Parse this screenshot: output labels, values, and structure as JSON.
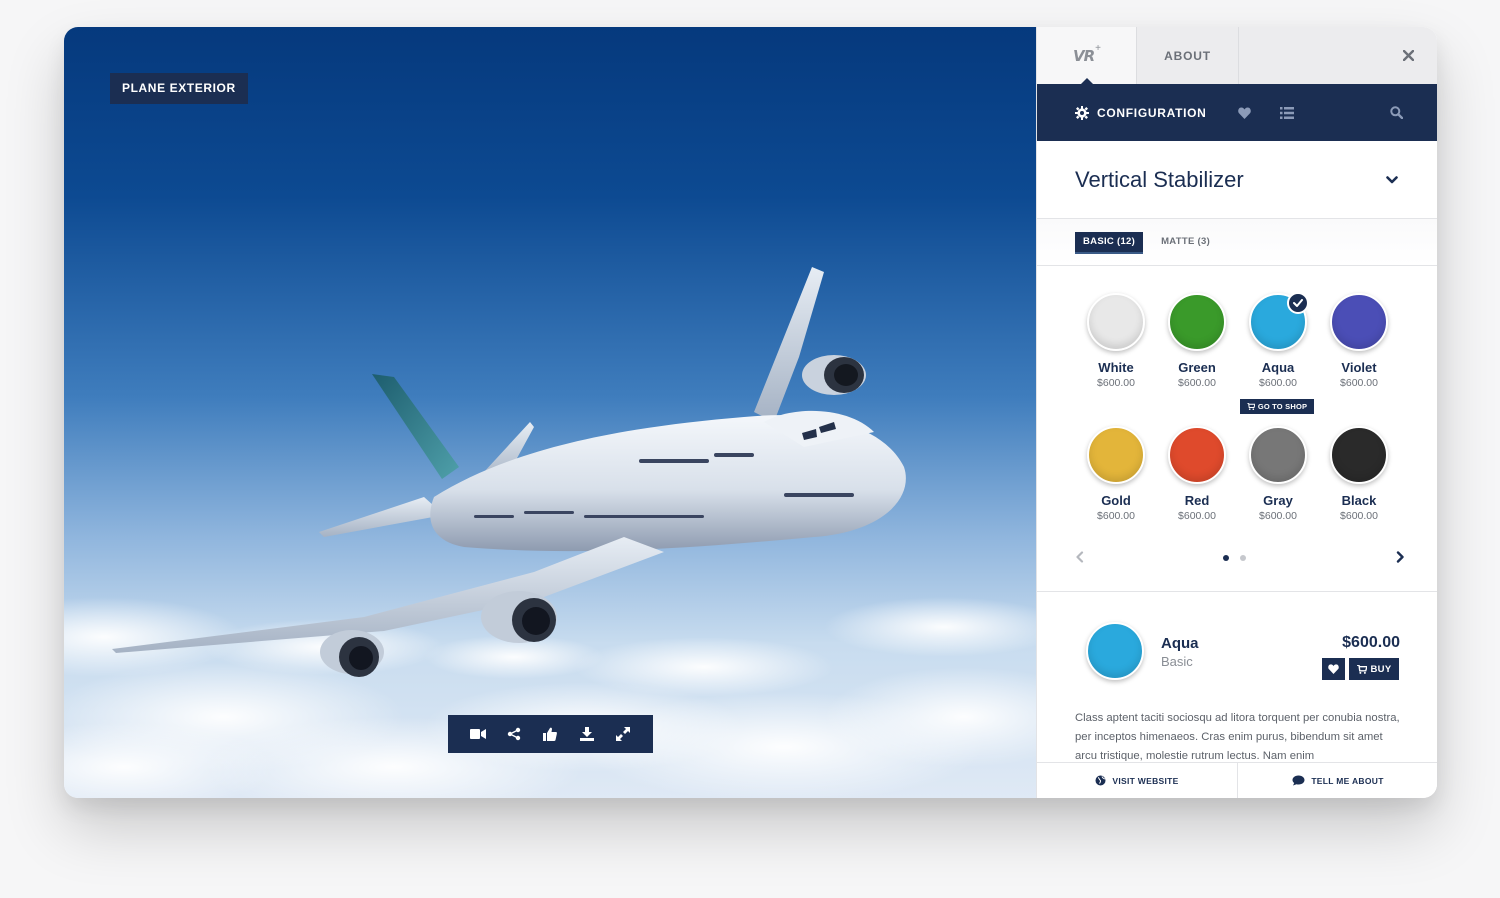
{
  "viewer": {
    "label": "PLANE EXTERIOR",
    "toolbar": [
      {
        "icon": "video-camera-icon"
      },
      {
        "icon": "share-icon"
      },
      {
        "icon": "thumbs-up-icon"
      },
      {
        "icon": "download-icon"
      },
      {
        "icon": "fullscreen-icon"
      }
    ]
  },
  "panel": {
    "logo_text": "VR",
    "logo_sup": "+",
    "about_tab": "ABOUT",
    "nav": {
      "configuration_label": "CONFIGURATION"
    },
    "section_title": "Vertical Stabilizer",
    "finish_tabs": [
      {
        "label": "BASIC (12)",
        "active": true
      },
      {
        "label": "MATTE (3)",
        "active": false
      }
    ],
    "swatches": [
      {
        "name": "White",
        "price": "$600.00",
        "color": "#e8e8e8",
        "selected": false
      },
      {
        "name": "Green",
        "price": "$600.00",
        "color": "#3a9a2a",
        "selected": false
      },
      {
        "name": "Aqua",
        "price": "$600.00",
        "color": "#2aa9dd",
        "selected": true
      },
      {
        "name": "Violet",
        "price": "$600.00",
        "color": "#4b4eb6",
        "selected": false
      },
      {
        "name": "Gold",
        "price": "$600.00",
        "color": "#e3b53a",
        "selected": false
      },
      {
        "name": "Red",
        "price": "$600.00",
        "color": "#df4a2c",
        "selected": false
      },
      {
        "name": "Gray",
        "price": "$600.00",
        "color": "#777777",
        "selected": false
      },
      {
        "name": "Black",
        "price": "$600.00",
        "color": "#2a2a2a",
        "selected": false
      }
    ],
    "go_to_shop": "GO TO SHOP",
    "pager": {
      "pages": 2,
      "current": 1
    },
    "selected": {
      "name": "Aqua",
      "finish": "Basic",
      "price": "$600.00",
      "color": "#2aa9dd",
      "buy_label": "BUY",
      "description": "Class aptent taciti sociosqu ad litora torquent per conubia nostra, per inceptos himenaeos. Cras enim purus, bibendum sit amet arcu tristique, molestie rutrum lectus. Nam enim"
    },
    "footer": {
      "visit_website": "VISIT WEBSITE",
      "tell_me_about": "TELL ME ABOUT"
    }
  },
  "colors": {
    "navy": "#1b2e52",
    "sky_top": "#05397d",
    "accent": "#2aa9dd"
  }
}
